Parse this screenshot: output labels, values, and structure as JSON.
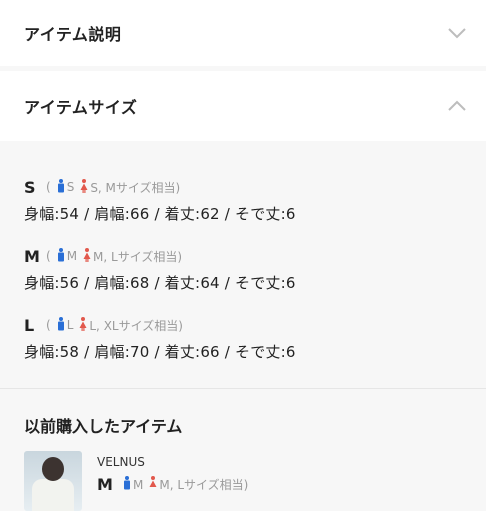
{
  "sections": {
    "description_title": "アイテム説明",
    "size_title": "アイテムサイズ"
  },
  "sizes": [
    {
      "letter": "S",
      "open": "(",
      "men": "S",
      "women": "S, Mサイズ相当)",
      "measure": "身幅:54 / 肩幅:66 / 着丈:62 / そで丈:6"
    },
    {
      "letter": "M",
      "open": "(",
      "men": "M",
      "women": "M, Lサイズ相当)",
      "measure": "身幅:56 / 肩幅:68 / 着丈:64 / そで丈:6"
    },
    {
      "letter": "L",
      "open": "(",
      "men": "L",
      "women": "L, XLサイズ相当)",
      "measure": "身幅:58 / 肩幅:70 / 着丈:66 / そで丈:6"
    }
  ],
  "previous": {
    "title": "以前購入したアイテム",
    "brand": "VELNUS",
    "size_letter": "M",
    "men": "M",
    "women": "M, Lサイズ相当)"
  },
  "colors": {
    "men_icon": "#2a6fd6",
    "women_icon": "#e2584c"
  }
}
